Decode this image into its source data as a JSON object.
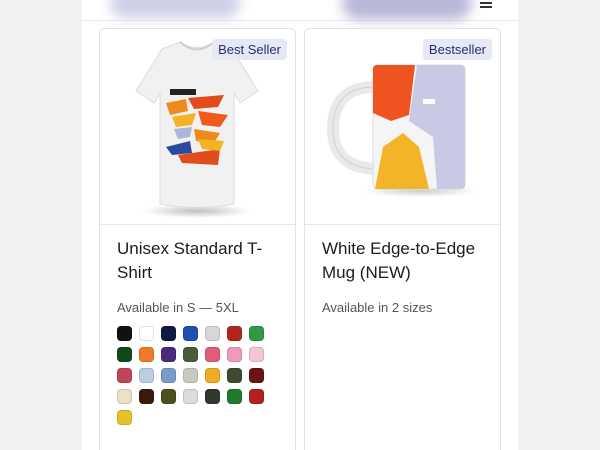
{
  "products": [
    {
      "badge": "Best Seller",
      "title": "Unisex Standard T-Shirt",
      "availability": "Available in S — 5XL",
      "colors": [
        "#111111",
        "#ffffff",
        "#0e1a44",
        "#1f4fb0",
        "#d7d7d7",
        "#b1261f",
        "#2e9a45",
        "#0f4a1a",
        "#f07a2a",
        "#4a2a7a",
        "#4a5a3a",
        "#e35c7a",
        "#ec9bbd",
        "#f2c7d2",
        "#c1455a",
        "#b9cfe4",
        "#7a9cc9",
        "#c9c9c4",
        "#f0ad23",
        "#3d4a2e",
        "#6a1414",
        "#ece0c8",
        "#3b1a0e",
        "#4d4f1e",
        "#dcdcdc",
        "#2f3a2c",
        "#1f7a2f",
        "#b22020",
        "#e4c22a"
      ]
    },
    {
      "badge": "Bestseller",
      "title": "White Edge-to-Edge Mug (NEW)",
      "availability": "Available in 2 sizes"
    }
  ]
}
